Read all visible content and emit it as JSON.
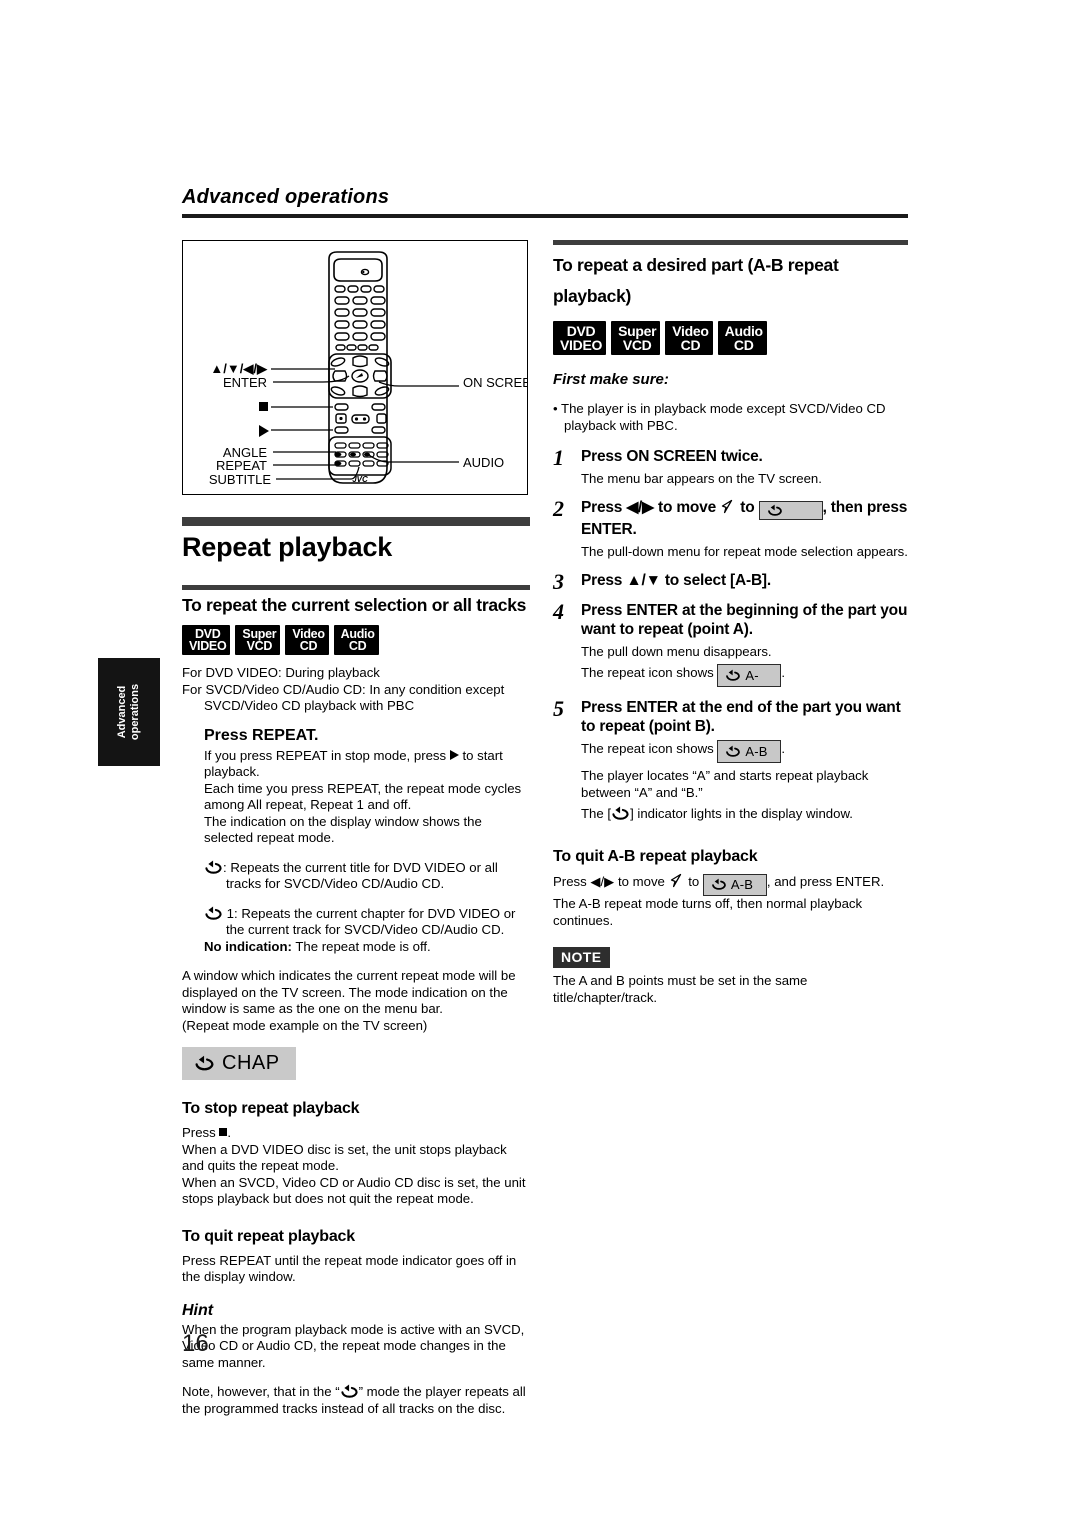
{
  "running_head": {
    "title": "Advanced operations"
  },
  "side_tab": {
    "line1": "Advanced",
    "line2": "operations"
  },
  "page_number": "16",
  "figure": {
    "name": "remote-control-diagram",
    "brand": "JVC",
    "labels": {
      "cursor": "▲/▼/◀/▶",
      "enter": "ENTER",
      "on_screen": "ON SCREEN",
      "angle": "ANGLE",
      "repeat": "REPEAT",
      "subtitle": "SUBTITLE",
      "audio": "AUDIO"
    }
  },
  "left": {
    "section_title": "Repeat playback",
    "sub_title": "To repeat the current selection or all tracks",
    "badges": [
      {
        "line1": "DVD",
        "line2": "VIDEO"
      },
      {
        "line1": "Super",
        "line2": "VCD"
      },
      {
        "line1": "Video",
        "line2": "CD"
      },
      {
        "line1": "Audio",
        "line2": "CD"
      }
    ],
    "cond_line1": "For DVD VIDEO: During playback",
    "cond_line2": "For SVCD/Video CD/Audio CD: In any condition except SVCD/Video CD playback with PBC",
    "press_repeat": "Press REPEAT.",
    "para1": "If you press REPEAT in stop mode, press ",
    "para1b": " to start playback.",
    "para2": "Each time you press REPEAT, the repeat mode cycles among All repeat, Repeat 1 and off.",
    "para3": "The indication on the display window shows the selected repeat mode.",
    "mode_all": ": Repeats the current title for DVD VIDEO or all tracks for SVCD/Video CD/Audio CD.",
    "mode_one": " 1: Repeats the current chapter for DVD VIDEO or the current track for SVCD/Video CD/Audio CD.",
    "mode_off_bold": "No indication:",
    "mode_off_rest": " The repeat mode is off.",
    "window_para": "A window which indicates the current repeat mode will be displayed on the TV screen. The mode indication on the window is same as the one on the menu bar.",
    "window_example": "(Repeat mode example on the TV screen)",
    "chap_chip": "CHAP",
    "stop_title": "To stop repeat playback",
    "stop_press": "Press ",
    "stop_press_tail": ".",
    "stop_para1": "When a DVD VIDEO disc is set, the unit stops playback and quits the repeat mode.",
    "stop_para2": "When an SVCD, Video CD or Audio CD disc is set, the unit stops playback but does not quit the repeat mode.",
    "quit_title": "To quit repeat playback",
    "quit_para": "Press REPEAT until the repeat mode indicator goes off in the display window.",
    "hint_title": "Hint",
    "hint_para1": "When the program playback mode is active with an SVCD, Video CD or Audio CD, the repeat mode changes in the same manner.",
    "hint_para2_a": "Note, however, that in the “",
    "hint_para2_b": "” mode the player repeats all the programmed tracks instead of all tracks on the disc."
  },
  "right": {
    "sub_title_l1": "To repeat a desired part (A-B repeat",
    "sub_title_l2": "playback)",
    "badges": [
      {
        "line1": "DVD",
        "line2": "VIDEO"
      },
      {
        "line1": "Super",
        "line2": "VCD"
      },
      {
        "line1": "Video",
        "line2": "CD"
      },
      {
        "line1": "Audio",
        "line2": "CD"
      }
    ],
    "first_make_sure": "First make sure:",
    "fms_bullet": "• The player is in playback mode except SVCD/Video CD playback with PBC.",
    "steps": [
      {
        "num": "1",
        "head": "Press ON SCREEN twice.",
        "body": "The menu bar appears on the TV screen."
      },
      {
        "num": "2",
        "head_a": "Press ◀/▶ to move ",
        "head_b": " to ",
        "head_c": ", then press ENTER.",
        "body": "The pull-down menu for repeat mode selection appears."
      },
      {
        "num": "3",
        "head": "Press ▲/▼ to select [A-B].",
        "body": ""
      },
      {
        "num": "4",
        "head": "Press ENTER at the beginning of the part you want to repeat (point A).",
        "body1": "The pull down menu disappears.",
        "body2_a": "The repeat icon shows ",
        "body2_chip": "A-",
        "body2_b": "."
      },
      {
        "num": "5",
        "head": "Press ENTER at the end of the part you want to repeat (point B).",
        "body1_a": "The repeat icon shows ",
        "body1_chip": "A-B",
        "body1_b": ".",
        "body2": "The player locates “A” and starts repeat playback between “A” and “B.”",
        "body3_a": "The [",
        "body3_b": "] indicator lights in the display window."
      }
    ],
    "quit_ab_title": "To quit A-B repeat playback",
    "quit_ab_a": "Press ◀/▶ to move ",
    "quit_ab_b": " to ",
    "quit_ab_chip": "A-B",
    "quit_ab_c": ", and press ENTER. The A-B repeat mode turns off, then normal playback continues.",
    "note_badge": "NOTE",
    "note_text": "The A and B points must be set in the same title/chapter/track."
  },
  "colors": {
    "rule": "#3d3d3d",
    "badge_bg": "#000000",
    "chip_bg": "#c8c8c8",
    "note_bg": "#2e2e2e",
    "tab_bg": "#141414"
  }
}
